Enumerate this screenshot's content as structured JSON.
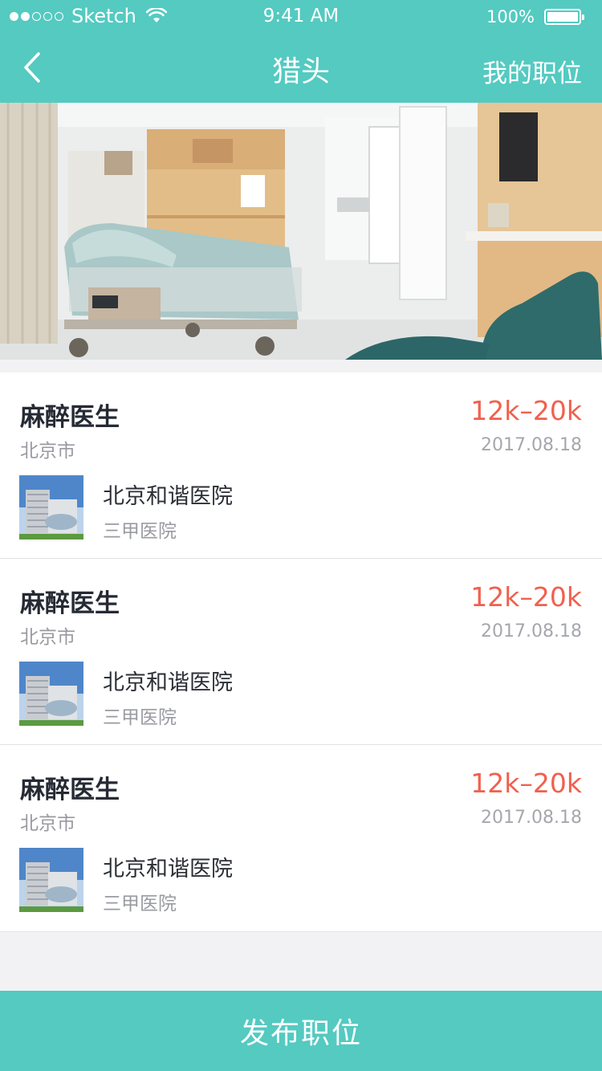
{
  "status_bar": {
    "carrier": "Sketch",
    "time": "9:41 AM",
    "battery": "100%"
  },
  "nav": {
    "title": "猎头",
    "right_action": "我的职位"
  },
  "jobs": [
    {
      "title": "麻醉医生",
      "salary": "12k–20k",
      "city": "北京市",
      "date": "2017.08.18",
      "org_name": "北京和谐医院",
      "org_type": "三甲医院"
    },
    {
      "title": "麻醉医生",
      "salary": "12k–20k",
      "city": "北京市",
      "date": "2017.08.18",
      "org_name": "北京和谐医院",
      "org_type": "三甲医院"
    },
    {
      "title": "麻醉医生",
      "salary": "12k–20k",
      "city": "北京市",
      "date": "2017.08.18",
      "org_name": "北京和谐医院",
      "org_type": "三甲医院"
    }
  ],
  "bottom_button": {
    "label": "发布职位"
  },
  "colors": {
    "accent": "#54cac1",
    "salary": "#f1604e",
    "title_text": "#252a34",
    "secondary_text": "#999aa0"
  },
  "icons": [
    "signal-dots-icon",
    "wifi-icon",
    "battery-icon",
    "back-chevron-icon"
  ]
}
